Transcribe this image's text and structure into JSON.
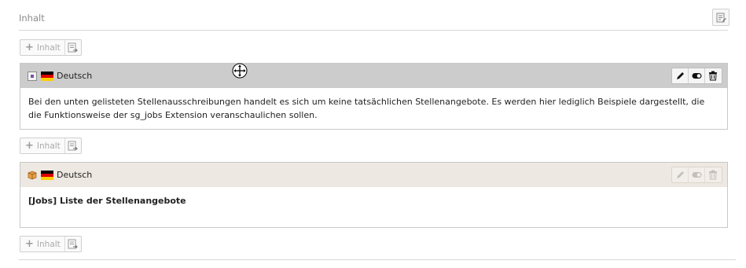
{
  "column": {
    "title": "Inhalt",
    "edit_icon": "edit-column-icon"
  },
  "new_content": {
    "label": "Inhalt",
    "plus_icon": "plus-icon",
    "paste_icon": "paste-icon"
  },
  "elements": [
    {
      "type_icon": "text-element-icon",
      "flag": "german-flag-icon",
      "language": "Deutsch",
      "selected": true,
      "body": "Bei den unten gelisteten Stellenausschreibungen handelt es sich um keine tatsächlichen Stellenangebote. Es werden hier lediglich Beispiele dargestellt, die die Funktionsweise der sg_jobs Extension veranschaulichen sollen."
    },
    {
      "type_icon": "plugin-element-icon",
      "flag": "german-flag-icon",
      "language": "Deutsch",
      "selected": false,
      "body": "[Jobs] Liste der Stellenangebote"
    }
  ],
  "actions": {
    "edit": "pencil-icon",
    "toggle": "toggle-visibility-icon",
    "delete": "trash-icon"
  },
  "colors": {
    "selected_header": "#cccccc",
    "normal_header": "#ede8e1",
    "border": "#c8c8c8",
    "flag_black": "#000000",
    "flag_red": "#dd0000",
    "flag_gold": "#ffce00"
  }
}
